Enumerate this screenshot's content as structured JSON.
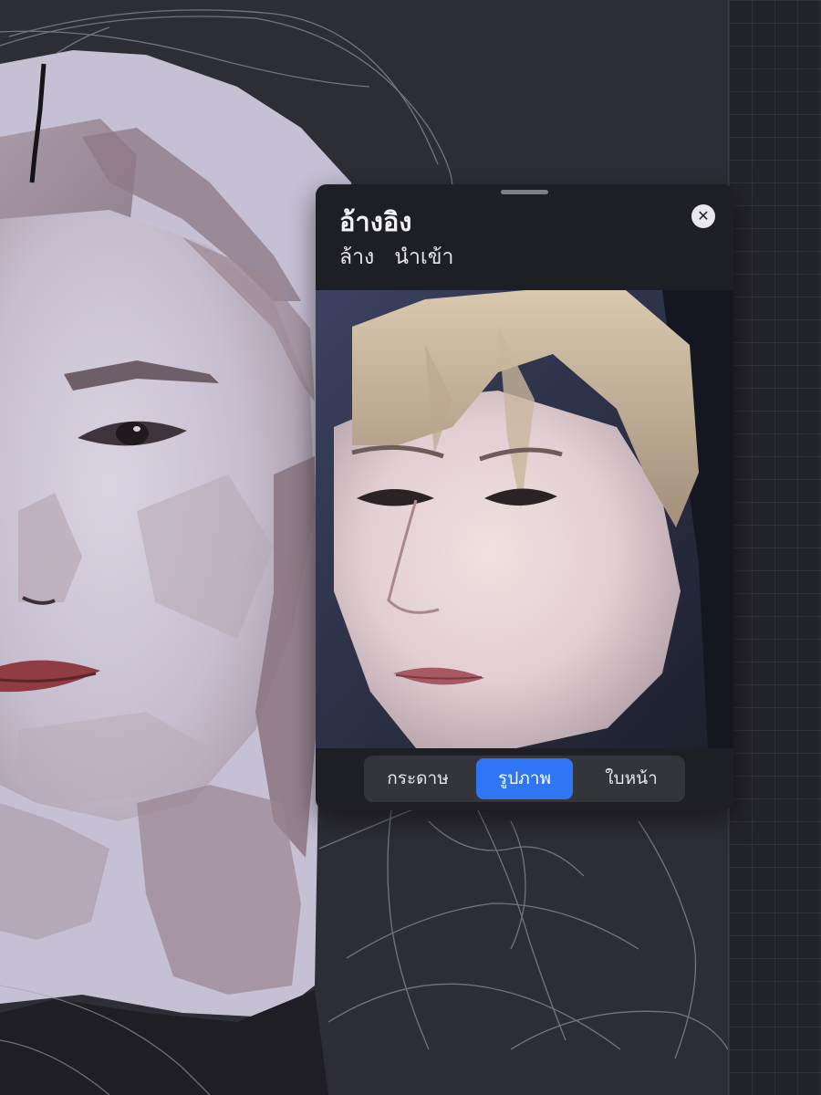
{
  "reference_panel": {
    "title": "อ้างอิง",
    "actions": {
      "clear_label": "ล้าง",
      "import_label": "นำเข้า"
    },
    "close_icon": "close-icon",
    "tabs": [
      {
        "label": "กระดาษ",
        "active": false
      },
      {
        "label": "รูปภาพ",
        "active": true
      },
      {
        "label": "ใบหน้า",
        "active": false
      }
    ]
  },
  "colors": {
    "accent": "#2f76f5",
    "panel_background": "#1e1f24",
    "canvas_background": "#2d2d35"
  }
}
